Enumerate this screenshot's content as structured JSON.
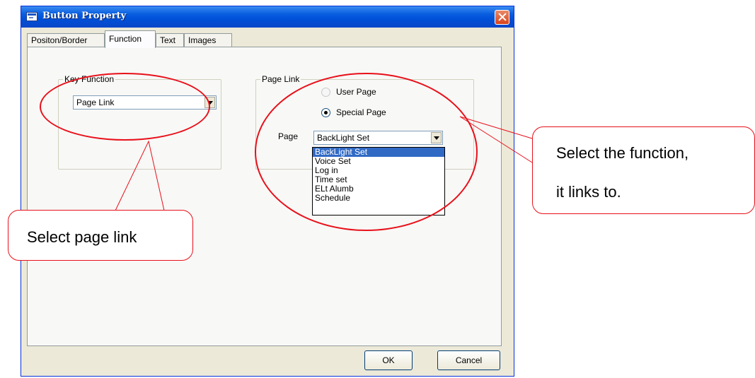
{
  "window": {
    "title": "Button Property"
  },
  "tabs": [
    "Positon/Border",
    "Function",
    "Text",
    "Images"
  ],
  "active_tab": "Function",
  "key_function": {
    "label": "Key Function",
    "value": "Page Link"
  },
  "page_link": {
    "label": "Page Link",
    "radio_user": "User Page",
    "radio_special": "Special Page",
    "selected_radio": "Special Page",
    "page_label": "Page",
    "page_value": "BackLight Set",
    "options": [
      "BackLight Set",
      "Voice Set",
      "Log in",
      "Time set",
      "ELt Alumb",
      "Schedule"
    ]
  },
  "buttons": {
    "ok": "OK",
    "cancel": "Cancel"
  },
  "annotations": {
    "select_page_link": "Select page link",
    "select_function_line1": "Select the function,",
    "select_function_line2": "it links to.",
    "color": "#e8101a"
  }
}
